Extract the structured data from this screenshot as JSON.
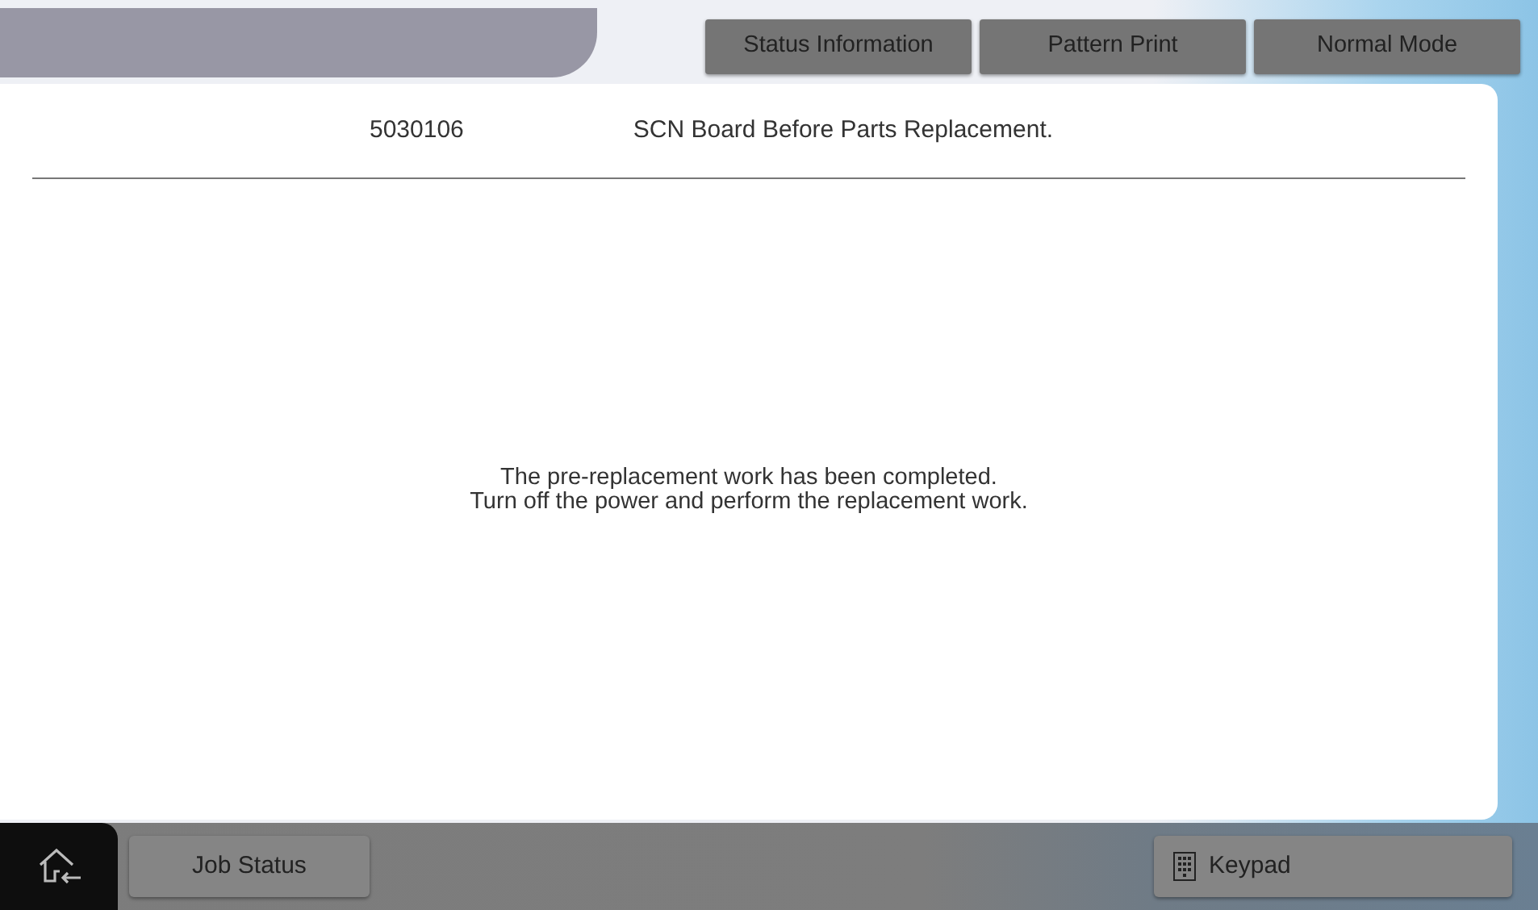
{
  "header_buttons": [
    {
      "label": "Status Information"
    },
    {
      "label": "Pattern Print"
    },
    {
      "label": "Normal Mode"
    }
  ],
  "panel": {
    "code": "5030106",
    "title": "SCN Board Before Parts Replacement.",
    "message": [
      "The pre-replacement work has been completed.",
      "Turn off the power and perform the replacement work."
    ]
  },
  "bottom_bar": {
    "left_button": "Job Status",
    "right_button": "Keypad"
  }
}
